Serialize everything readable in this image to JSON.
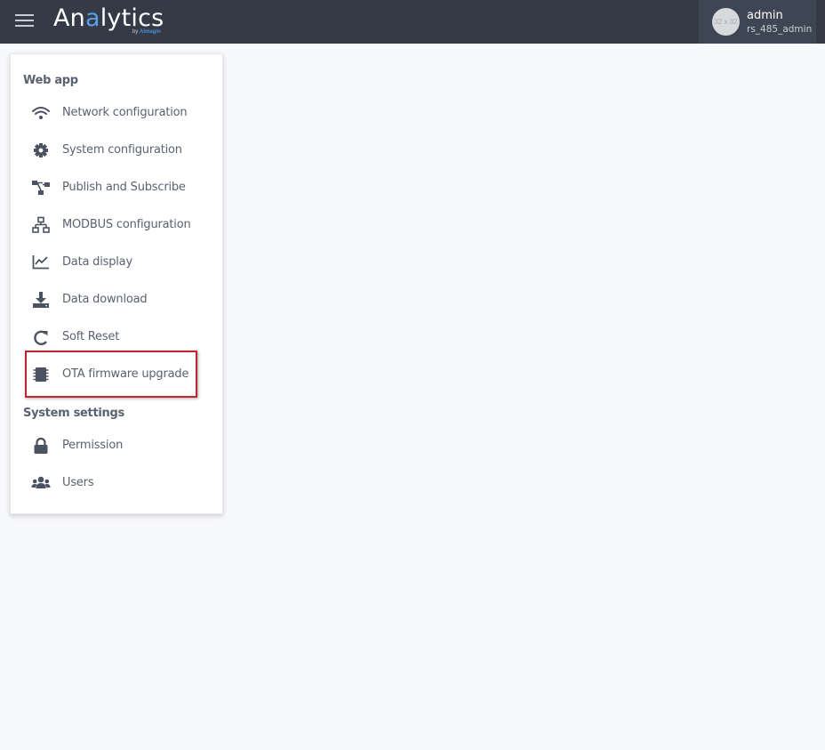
{
  "header": {
    "logo": {
      "text_pre": "An",
      "text_accent": "a",
      "text_post": "lytics",
      "sub_pre": "by ",
      "sub_brand": "Almagin"
    },
    "user": {
      "avatar_text": "32 x 32",
      "name": "admin",
      "role": "rs_485_admin"
    }
  },
  "menu": {
    "sections": [
      {
        "title": "Web app"
      },
      {
        "title": "System settings"
      }
    ],
    "items": [
      {
        "label": "Network configuration",
        "icon": "wifi-icon"
      },
      {
        "label": "System configuration",
        "icon": "gear-icon"
      },
      {
        "label": "Publish and Subscribe",
        "icon": "hierarchy-icon"
      },
      {
        "label": "MODBUS configuration",
        "icon": "network-icon"
      },
      {
        "label": "Data display",
        "icon": "line-chart-icon"
      },
      {
        "label": "Data download",
        "icon": "download-icon"
      },
      {
        "label": "Soft Reset",
        "icon": "refresh-icon"
      },
      {
        "label": "OTA firmware upgrade",
        "icon": "chip-icon"
      },
      {
        "label": "Permission",
        "icon": "lock-icon"
      },
      {
        "label": "Users",
        "icon": "users-icon"
      }
    ]
  },
  "colors": {
    "topbar": "#343a46",
    "accent": "#5aa0e6",
    "highlight": "#c0272d",
    "menu_text": "#5a6270"
  }
}
